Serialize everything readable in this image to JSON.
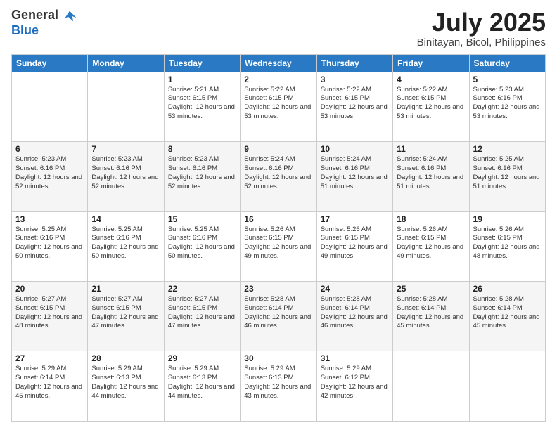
{
  "header": {
    "logo_general": "General",
    "logo_blue": "Blue",
    "month_title": "July 2025",
    "location": "Binitayan, Bicol, Philippines"
  },
  "weekdays": [
    "Sunday",
    "Monday",
    "Tuesday",
    "Wednesday",
    "Thursday",
    "Friday",
    "Saturday"
  ],
  "weeks": [
    [
      {
        "day": "",
        "sunrise": "",
        "sunset": "",
        "daylight": ""
      },
      {
        "day": "",
        "sunrise": "",
        "sunset": "",
        "daylight": ""
      },
      {
        "day": "1",
        "sunrise": "Sunrise: 5:21 AM",
        "sunset": "Sunset: 6:15 PM",
        "daylight": "Daylight: 12 hours and 53 minutes."
      },
      {
        "day": "2",
        "sunrise": "Sunrise: 5:22 AM",
        "sunset": "Sunset: 6:15 PM",
        "daylight": "Daylight: 12 hours and 53 minutes."
      },
      {
        "day": "3",
        "sunrise": "Sunrise: 5:22 AM",
        "sunset": "Sunset: 6:15 PM",
        "daylight": "Daylight: 12 hours and 53 minutes."
      },
      {
        "day": "4",
        "sunrise": "Sunrise: 5:22 AM",
        "sunset": "Sunset: 6:15 PM",
        "daylight": "Daylight: 12 hours and 53 minutes."
      },
      {
        "day": "5",
        "sunrise": "Sunrise: 5:23 AM",
        "sunset": "Sunset: 6:16 PM",
        "daylight": "Daylight: 12 hours and 53 minutes."
      }
    ],
    [
      {
        "day": "6",
        "sunrise": "Sunrise: 5:23 AM",
        "sunset": "Sunset: 6:16 PM",
        "daylight": "Daylight: 12 hours and 52 minutes."
      },
      {
        "day": "7",
        "sunrise": "Sunrise: 5:23 AM",
        "sunset": "Sunset: 6:16 PM",
        "daylight": "Daylight: 12 hours and 52 minutes."
      },
      {
        "day": "8",
        "sunrise": "Sunrise: 5:23 AM",
        "sunset": "Sunset: 6:16 PM",
        "daylight": "Daylight: 12 hours and 52 minutes."
      },
      {
        "day": "9",
        "sunrise": "Sunrise: 5:24 AM",
        "sunset": "Sunset: 6:16 PM",
        "daylight": "Daylight: 12 hours and 52 minutes."
      },
      {
        "day": "10",
        "sunrise": "Sunrise: 5:24 AM",
        "sunset": "Sunset: 6:16 PM",
        "daylight": "Daylight: 12 hours and 51 minutes."
      },
      {
        "day": "11",
        "sunrise": "Sunrise: 5:24 AM",
        "sunset": "Sunset: 6:16 PM",
        "daylight": "Daylight: 12 hours and 51 minutes."
      },
      {
        "day": "12",
        "sunrise": "Sunrise: 5:25 AM",
        "sunset": "Sunset: 6:16 PM",
        "daylight": "Daylight: 12 hours and 51 minutes."
      }
    ],
    [
      {
        "day": "13",
        "sunrise": "Sunrise: 5:25 AM",
        "sunset": "Sunset: 6:16 PM",
        "daylight": "Daylight: 12 hours and 50 minutes."
      },
      {
        "day": "14",
        "sunrise": "Sunrise: 5:25 AM",
        "sunset": "Sunset: 6:16 PM",
        "daylight": "Daylight: 12 hours and 50 minutes."
      },
      {
        "day": "15",
        "sunrise": "Sunrise: 5:25 AM",
        "sunset": "Sunset: 6:16 PM",
        "daylight": "Daylight: 12 hours and 50 minutes."
      },
      {
        "day": "16",
        "sunrise": "Sunrise: 5:26 AM",
        "sunset": "Sunset: 6:15 PM",
        "daylight": "Daylight: 12 hours and 49 minutes."
      },
      {
        "day": "17",
        "sunrise": "Sunrise: 5:26 AM",
        "sunset": "Sunset: 6:15 PM",
        "daylight": "Daylight: 12 hours and 49 minutes."
      },
      {
        "day": "18",
        "sunrise": "Sunrise: 5:26 AM",
        "sunset": "Sunset: 6:15 PM",
        "daylight": "Daylight: 12 hours and 49 minutes."
      },
      {
        "day": "19",
        "sunrise": "Sunrise: 5:26 AM",
        "sunset": "Sunset: 6:15 PM",
        "daylight": "Daylight: 12 hours and 48 minutes."
      }
    ],
    [
      {
        "day": "20",
        "sunrise": "Sunrise: 5:27 AM",
        "sunset": "Sunset: 6:15 PM",
        "daylight": "Daylight: 12 hours and 48 minutes."
      },
      {
        "day": "21",
        "sunrise": "Sunrise: 5:27 AM",
        "sunset": "Sunset: 6:15 PM",
        "daylight": "Daylight: 12 hours and 47 minutes."
      },
      {
        "day": "22",
        "sunrise": "Sunrise: 5:27 AM",
        "sunset": "Sunset: 6:15 PM",
        "daylight": "Daylight: 12 hours and 47 minutes."
      },
      {
        "day": "23",
        "sunrise": "Sunrise: 5:28 AM",
        "sunset": "Sunset: 6:14 PM",
        "daylight": "Daylight: 12 hours and 46 minutes."
      },
      {
        "day": "24",
        "sunrise": "Sunrise: 5:28 AM",
        "sunset": "Sunset: 6:14 PM",
        "daylight": "Daylight: 12 hours and 46 minutes."
      },
      {
        "day": "25",
        "sunrise": "Sunrise: 5:28 AM",
        "sunset": "Sunset: 6:14 PM",
        "daylight": "Daylight: 12 hours and 45 minutes."
      },
      {
        "day": "26",
        "sunrise": "Sunrise: 5:28 AM",
        "sunset": "Sunset: 6:14 PM",
        "daylight": "Daylight: 12 hours and 45 minutes."
      }
    ],
    [
      {
        "day": "27",
        "sunrise": "Sunrise: 5:29 AM",
        "sunset": "Sunset: 6:14 PM",
        "daylight": "Daylight: 12 hours and 45 minutes."
      },
      {
        "day": "28",
        "sunrise": "Sunrise: 5:29 AM",
        "sunset": "Sunset: 6:13 PM",
        "daylight": "Daylight: 12 hours and 44 minutes."
      },
      {
        "day": "29",
        "sunrise": "Sunrise: 5:29 AM",
        "sunset": "Sunset: 6:13 PM",
        "daylight": "Daylight: 12 hours and 44 minutes."
      },
      {
        "day": "30",
        "sunrise": "Sunrise: 5:29 AM",
        "sunset": "Sunset: 6:13 PM",
        "daylight": "Daylight: 12 hours and 43 minutes."
      },
      {
        "day": "31",
        "sunrise": "Sunrise: 5:29 AM",
        "sunset": "Sunset: 6:12 PM",
        "daylight": "Daylight: 12 hours and 42 minutes."
      },
      {
        "day": "",
        "sunrise": "",
        "sunset": "",
        "daylight": ""
      },
      {
        "day": "",
        "sunrise": "",
        "sunset": "",
        "daylight": ""
      }
    ]
  ]
}
